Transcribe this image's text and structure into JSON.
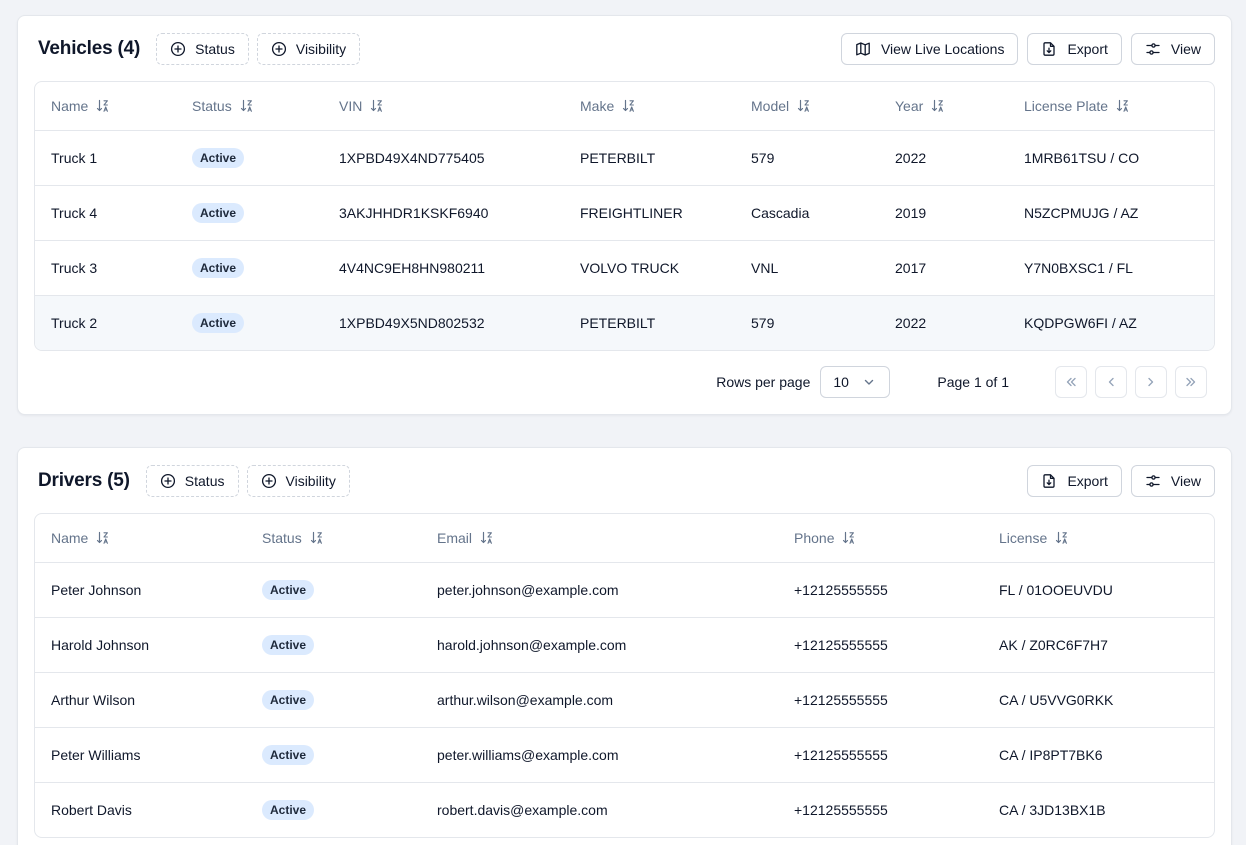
{
  "colors": {
    "background": "#f1f3f7",
    "badge_bg": "#dbeafe",
    "header_text": "#64748b",
    "border": "#e4e7ec"
  },
  "icons": {
    "filter": "plus-circle-icon",
    "map": "map-icon",
    "export": "file-export-icon",
    "view": "sliders-icon",
    "sort": "sort-icon"
  },
  "vehicles": {
    "title": "Vehicles (4)",
    "filters": {
      "status": "Status",
      "visibility": "Visibility"
    },
    "actions": {
      "live_locations": "View Live Locations",
      "export": "Export",
      "view": "View"
    },
    "columns": [
      "Name",
      "Status",
      "VIN",
      "Make",
      "Model",
      "Year",
      "License Plate"
    ],
    "rows": [
      [
        "Truck 1",
        "Active",
        "1XPBD49X4ND775405",
        "PETERBILT",
        "579",
        "2022",
        "1MRB61TSU / CO"
      ],
      [
        "Truck 4",
        "Active",
        "3AKJHHDR1KSKF6940",
        "FREIGHTLINER",
        "Cascadia",
        "2019",
        "N5ZCPMUJG / AZ"
      ],
      [
        "Truck 3",
        "Active",
        "4V4NC9EH8HN980211",
        "VOLVO TRUCK",
        "VNL",
        "2017",
        "Y7N0BXSC1 / FL"
      ],
      [
        "Truck 2",
        "Active",
        "1XPBD49X5ND802532",
        "PETERBILT",
        "579",
        "2022",
        "KQDPGW6FI / AZ"
      ]
    ],
    "pagination": {
      "rows_per_page_label": "Rows per page",
      "rows_per_page_value": "10",
      "page_label": "Page 1 of 1"
    }
  },
  "drivers": {
    "title": "Drivers (5)",
    "filters": {
      "status": "Status",
      "visibility": "Visibility"
    },
    "actions": {
      "export": "Export",
      "view": "View"
    },
    "columns": [
      "Name",
      "Status",
      "Email",
      "Phone",
      "License"
    ],
    "rows": [
      [
        "Peter Johnson",
        "Active",
        "peter.johnson@example.com",
        "+12125555555",
        "FL / 01OOEUVDU"
      ],
      [
        "Harold Johnson",
        "Active",
        "harold.johnson@example.com",
        "+12125555555",
        "AK / Z0RC6F7H7"
      ],
      [
        "Arthur Wilson",
        "Active",
        "arthur.wilson@example.com",
        "+12125555555",
        "CA / U5VVG0RKK"
      ],
      [
        "Peter Williams",
        "Active",
        "peter.williams@example.com",
        "+12125555555",
        "CA / IP8PT7BK6"
      ],
      [
        "Robert Davis",
        "Active",
        "robert.davis@example.com",
        "+12125555555",
        "CA / 3JD13BX1B"
      ]
    ]
  }
}
